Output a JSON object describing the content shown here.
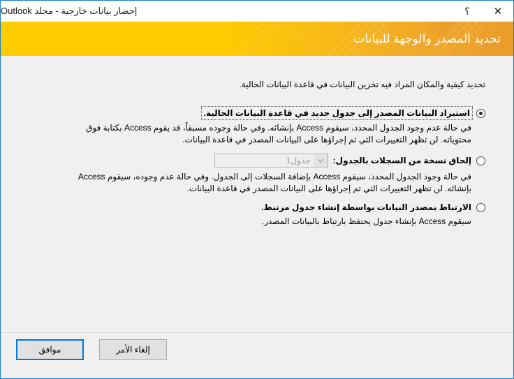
{
  "window": {
    "title": "إحضار بيانات خارجية - مجلد Outlook",
    "help_icon": "؟",
    "close_icon": "✕"
  },
  "banner": {
    "heading": "تحديد المصدر والوجهة للبيانات",
    "background_color": "#ffcc00",
    "accent_color": "#eb9e2d",
    "text_color": "#ffffff"
  },
  "content": {
    "intro": "تحديد كيفية والمكان المراد فيه تخزين البيانات في قاعدة البيانات الحالية.",
    "options": [
      {
        "label": "استيراد البيانات المصدر إلى جدول جديد في قاعدة البيانات الحالية.",
        "selected": "true",
        "focused": "true",
        "description": "في حالة عدم وجود الجدول المحدد، سيقوم Access بإنشائه. وفي حالة وجوده مسبقاً، قد يقوم Access بكتابة فوق محتوياته. لن تظهر التغييرات التي تم إجراؤها على البيانات المصدر في قاعدة البيانات."
      },
      {
        "label": "إلحاق نسخة من السجلات بالجدول:",
        "selected": "false",
        "focused": "false",
        "combo": {
          "value": "جدول1",
          "enabled": "false",
          "arrow_icon": "chevron-down-icon"
        },
        "description": "في حالة وجود الجدول المحدد، سيقوم Access بإضافة السجلات إلى الجدول. وفي حالة عدم وجوده، سيقوم Access بإنشائه. لن تظهر التغييرات التي تم إجراؤها على البيانات المصدر في قاعدة البيانات."
      },
      {
        "label": "الارتباط بمصدر البيانات بواسطة إنشاء جدول مرتبط.",
        "selected": "false",
        "focused": "false",
        "description": "سيقوم Access بإنشاء جدول يحتفظ بارتباط بالبيانات المصدر."
      }
    ]
  },
  "footer": {
    "ok_label": "موافق",
    "cancel_label": "إلغاء الأمر",
    "primary_border_color": "#0078d7"
  }
}
